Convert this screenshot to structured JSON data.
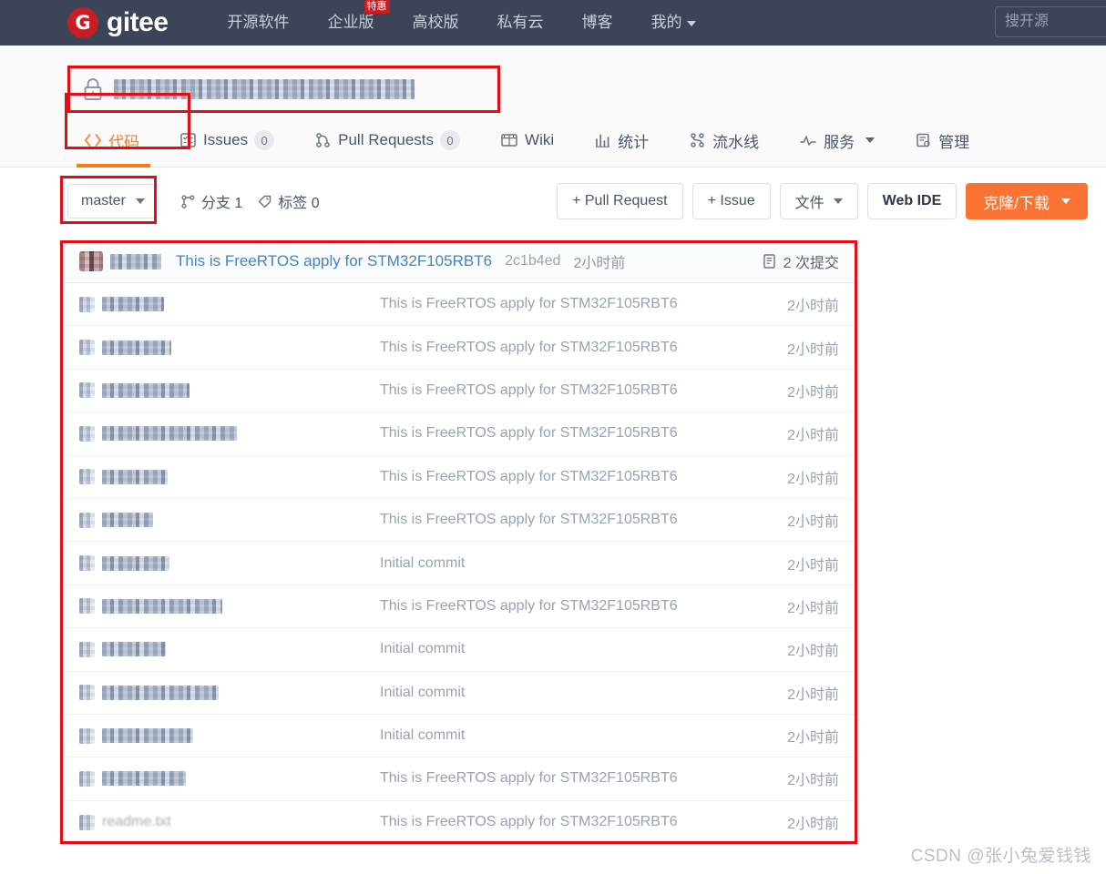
{
  "topnav": {
    "brand_mark": "G",
    "brand_text": "gitee",
    "search_placeholder": "搜开源",
    "search_value": "",
    "links": [
      {
        "label": "开源软件",
        "badge": ""
      },
      {
        "label": "企业版",
        "badge": "特惠"
      },
      {
        "label": "高校版",
        "badge": ""
      },
      {
        "label": "私有云",
        "badge": ""
      },
      {
        "label": "博客",
        "badge": ""
      },
      {
        "label": "我的",
        "badge": "",
        "has_caret": true
      }
    ]
  },
  "repo": {
    "visibility_icon": "lock-icon",
    "title_obscured": true,
    "title_text": ""
  },
  "tabs": [
    {
      "label": "代码",
      "icon": "code-icon",
      "count": "",
      "active": true
    },
    {
      "label": "Issues",
      "icon": "issue-icon",
      "count": "0",
      "active": false
    },
    {
      "label": "Pull Requests",
      "icon": "pull-request-icon",
      "count": "0",
      "active": false
    },
    {
      "label": "Wiki",
      "icon": "book-icon",
      "count": "",
      "active": false
    },
    {
      "label": "统计",
      "icon": "chart-icon",
      "count": "",
      "active": false
    },
    {
      "label": "流水线",
      "icon": "pipeline-icon",
      "count": "",
      "active": false
    },
    {
      "label": "服务",
      "icon": "activity-icon",
      "count": "",
      "active": false,
      "has_caret": true
    },
    {
      "label": "管理",
      "icon": "settings-icon",
      "count": "",
      "active": false
    }
  ],
  "toolbar": {
    "branch_label": "master",
    "branches_label": "分支 1",
    "tags_label": "标签 0",
    "pull_request_button": "+ Pull Request",
    "issue_button": "+ Issue",
    "files_button": "文件",
    "web_ide_button": "Web IDE",
    "clone_button": "克隆/下载"
  },
  "commit_head": {
    "author_obscured": true,
    "message": "This is FreeRTOS apply for STM32F105RBT6",
    "hash": "2c1b4ed",
    "time": "2小时前",
    "commit_count_label": "2 次提交"
  },
  "file_rows": [
    {
      "name": "",
      "name_obscured": true,
      "name_width": 68,
      "icon": "folder-icon",
      "message": "This is FreeRTOS apply for STM32F105RBT6",
      "time": "2小时前"
    },
    {
      "name": "",
      "name_obscured": true,
      "name_width": 76,
      "icon": "folder-icon",
      "message": "This is FreeRTOS apply for STM32F105RBT6",
      "time": "2小时前"
    },
    {
      "name": "",
      "name_obscured": true,
      "name_width": 96,
      "icon": "folder-icon",
      "message": "This is FreeRTOS apply for STM32F105RBT6",
      "time": "2小时前"
    },
    {
      "name": "",
      "name_obscured": true,
      "name_width": 148,
      "icon": "folder-icon",
      "message": "This is FreeRTOS apply for STM32F105RBT6",
      "time": "2小时前"
    },
    {
      "name": "",
      "name_obscured": true,
      "name_width": 72,
      "icon": "folder-icon",
      "message": "This is FreeRTOS apply for STM32F105RBT6",
      "time": "2小时前"
    },
    {
      "name": "",
      "name_obscured": true,
      "name_width": 56,
      "icon": "folder-icon",
      "message": "This is FreeRTOS apply for STM32F105RBT6",
      "time": "2小时前"
    },
    {
      "name": "",
      "name_obscured": true,
      "name_width": 74,
      "icon": "file-icon",
      "message": "Initial commit",
      "time": "2小时前"
    },
    {
      "name": "",
      "name_obscured": true,
      "name_width": 132,
      "icon": "file-icon",
      "message": "This is FreeRTOS apply for STM32F105RBT6",
      "time": "2小时前"
    },
    {
      "name": "",
      "name_obscured": true,
      "name_width": 70,
      "icon": "file-icon",
      "message": "Initial commit",
      "time": "2小时前"
    },
    {
      "name": "",
      "name_obscured": true,
      "name_width": 128,
      "icon": "file-icon",
      "message": "Initial commit",
      "time": "2小时前"
    },
    {
      "name": "",
      "name_obscured": true,
      "name_width": 100,
      "icon": "file-icon",
      "message": "Initial commit",
      "time": "2小时前"
    },
    {
      "name": "",
      "name_obscured": true,
      "name_width": 92,
      "icon": "file-icon",
      "message": "This is FreeRTOS apply for STM32F105RBT6",
      "time": "2小时前"
    },
    {
      "name": "readme.txt",
      "name_obscured": false,
      "name_width": 0,
      "icon": "file-icon",
      "message": "This is FreeRTOS apply for STM32F105RBT6",
      "time": "2小时前"
    }
  ],
  "watermark": "CSDN @张小兔爱钱钱",
  "colors": {
    "nav_bg": "#3c4457",
    "brand_red": "#c71d23",
    "accent_orange": "#ff7a1a",
    "primary_button": "#fa7333",
    "highlight_red": "#e60c15",
    "link_blue": "#4183c4",
    "muted_text": "#98a2b1"
  }
}
